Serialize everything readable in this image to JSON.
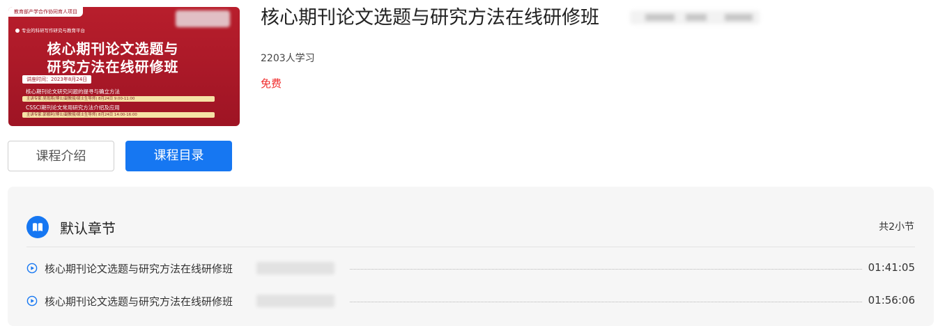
{
  "course": {
    "cover": {
      "top_tag": "教育部产学合作协同育人项目",
      "brand": "专业的科研写作研究与教育平台",
      "title_line1": "核心期刊论文选题与",
      "title_line2": "研究方法在线研修班",
      "date": "讲座时间：2023年8月24日",
      "topic1": "核心期刊论文研究问题的提寻与确立方法",
      "topic1_detail": "主讲专家:吴雨燕(博士/副教授/硕士生导师) 8月24日 9:00-11:00",
      "topic2": "CSSCI期刊论文常用研究方法介绍及应用",
      "topic2_detail": "主讲专家:郭顺利(博士/副教授/硕士生导师) 8月24日 14:00-16:00"
    },
    "title": "核心期刊论文选题与研究方法在线研修班",
    "learners": "2203人学习",
    "price": "免费"
  },
  "tabs": {
    "intro": "课程介绍",
    "catalog": "课程目录",
    "active": "catalog"
  },
  "chapter": {
    "title": "默认章节",
    "count": "共2小节",
    "lessons": [
      {
        "name": "核心期刊论文选题与研究方法在线研修班",
        "duration": "01:41:05"
      },
      {
        "name": "核心期刊论文选题与研究方法在线研修班",
        "duration": "01:56:06"
      }
    ]
  },
  "colors": {
    "accent": "#1677f2",
    "price": "#f02a2a",
    "cover_red": "#b81e2c"
  },
  "icons": [
    "book-icon",
    "play-circle-icon"
  ]
}
